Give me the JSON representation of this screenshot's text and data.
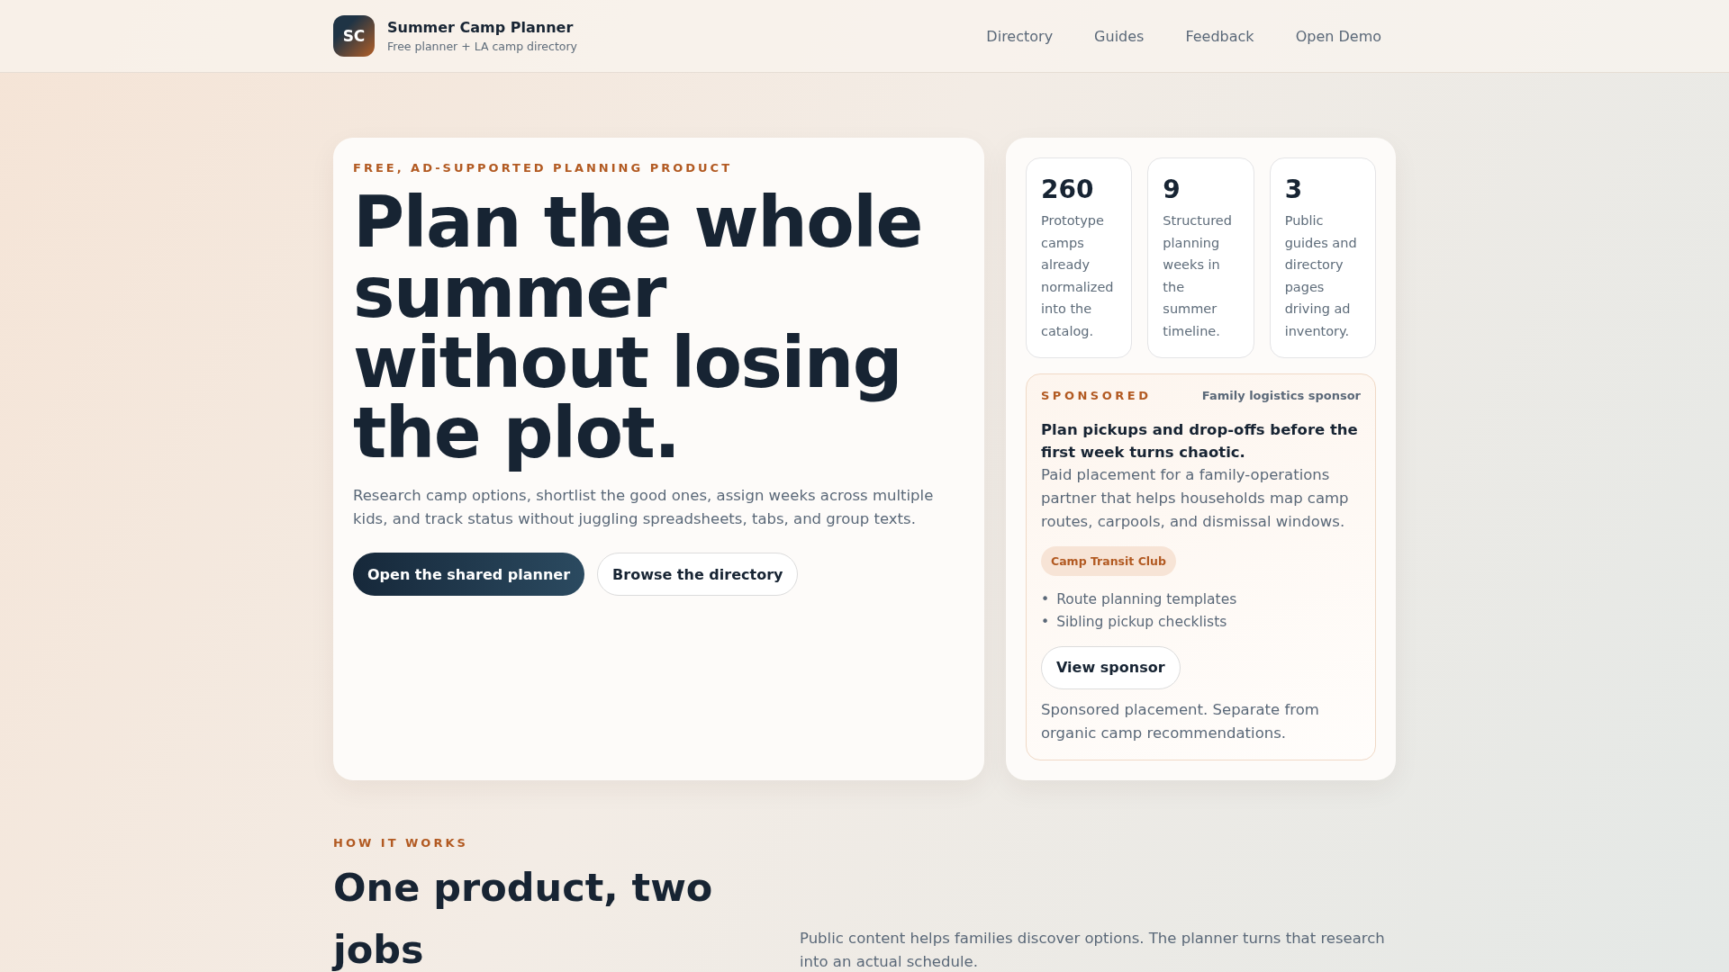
{
  "header": {
    "logo": "SC",
    "title": "Summer Camp Planner",
    "subtitle": "Free planner + LA camp directory",
    "nav": [
      "Directory",
      "Guides",
      "Feedback",
      "Open Demo"
    ]
  },
  "hero": {
    "eyebrow": "FREE, AD-SUPPORTED PLANNING PRODUCT",
    "headline": "Plan the whole summer without losing the plot.",
    "lead": "Research camp options, shortlist the good ones, assign weeks across multiple kids, and track status without juggling spreadsheets, tabs, and group texts.",
    "buttons": [
      {
        "label": "Open the shared planner",
        "kind": "primary"
      },
      {
        "label": "Browse the directory",
        "kind": "secondary"
      }
    ]
  },
  "stats": [
    {
      "value": "260",
      "label": "Prototype camps already normalized into the catalog."
    },
    {
      "value": "9",
      "label": "Structured planning weeks in the summer timeline."
    },
    {
      "value": "3",
      "label": "Public guides and directory pages driving ad inventory."
    }
  ],
  "sponsored": {
    "eyebrow": "SPONSORED",
    "sponsor_type": "Family logistics sponsor",
    "title": "Plan pickups and drop-offs before the first week turns chaotic.",
    "body": "Paid placement for a family-operations partner that helps households map camp routes, carpools, and dismissal windows.",
    "tag": "Camp Transit Club",
    "bullets": [
      {
        "marker": "•",
        "text": "Route planning templates"
      },
      {
        "marker": "•",
        "text": "Sibling pickup checklists"
      }
    ],
    "button": "View sponsor",
    "note": "Sponsored placement. Separate from organic camp recommendations."
  },
  "how_it_works": {
    "eyebrow": "HOW IT WORKS",
    "heading": "One product, two jobs",
    "text": "Public content helps families discover options. The planner turns that research into an actual schedule."
  }
}
